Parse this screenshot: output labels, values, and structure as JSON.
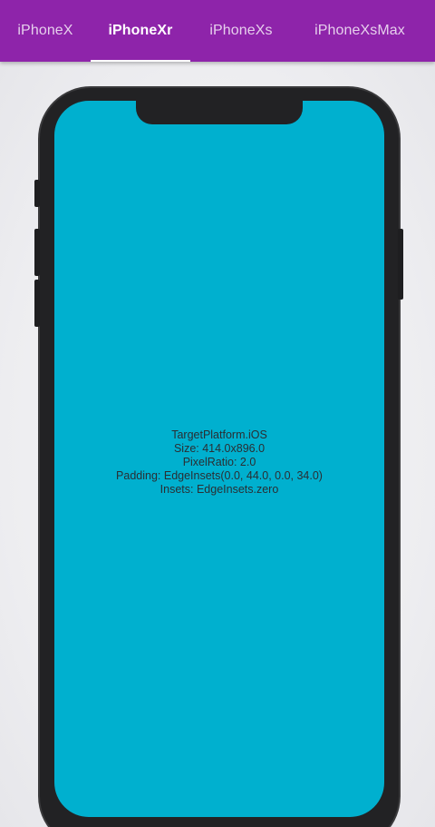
{
  "tabs": [
    {
      "label": "iPhoneX",
      "active": false
    },
    {
      "label": "iPhoneXr",
      "active": true
    },
    {
      "label": "iPhoneXs",
      "active": false
    },
    {
      "label": "iPhoneXsMax",
      "active": false
    }
  ],
  "colors": {
    "app_bar": "#8e24aa",
    "screen": "#00b0cf",
    "device_frame": "#222224",
    "indicator": "#ffffff"
  },
  "device_info": {
    "platform": "TargetPlatform.iOS",
    "size": "Size: 414.0x896.0",
    "pixel_ratio": "PixelRatio: 2.0",
    "padding": "Padding: EdgeInsets(0.0, 44.0, 0.0, 34.0)",
    "insets": "Insets: EdgeInsets.zero"
  }
}
